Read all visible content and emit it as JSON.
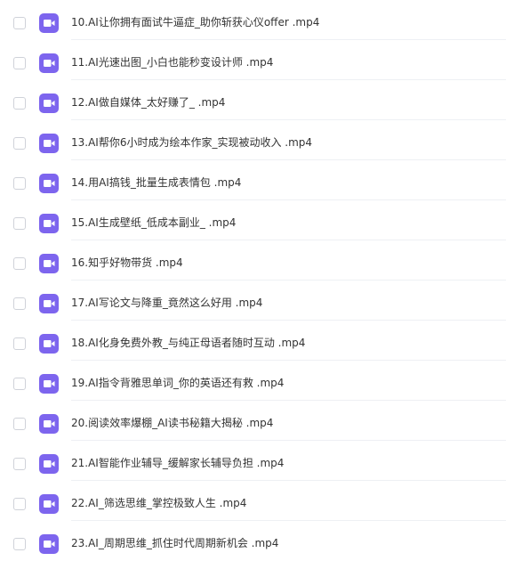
{
  "files": [
    {
      "name": "10.AI让你拥有面试牛逼症_助你斩获心仪offer .mp4",
      "icon": "video-file-icon"
    },
    {
      "name": "11.AI光速出图_小白也能秒变设计师 .mp4",
      "icon": "video-file-icon"
    },
    {
      "name": "12.AI做自媒体_太好赚了_ .mp4",
      "icon": "video-file-icon"
    },
    {
      "name": "13.AI帮你6小时成为绘本作家_实现被动收入 .mp4",
      "icon": "video-file-icon"
    },
    {
      "name": "14.用AI搞钱_批量生成表情包 .mp4",
      "icon": "video-file-icon"
    },
    {
      "name": "15.AI生成壁纸_低成本副业_ .mp4",
      "icon": "video-file-icon"
    },
    {
      "name": "16.知乎好物带货 .mp4",
      "icon": "video-file-icon"
    },
    {
      "name": "17.AI写论文与降重_竟然这么好用 .mp4",
      "icon": "video-file-icon"
    },
    {
      "name": "18.AI化身免费外教_与纯正母语者随时互动 .mp4",
      "icon": "video-file-icon"
    },
    {
      "name": "19.AI指令背雅思单词_你的英语还有救 .mp4",
      "icon": "video-file-icon"
    },
    {
      "name": "20.阅读效率爆棚_AI读书秘籍大揭秘 .mp4",
      "icon": "video-file-icon"
    },
    {
      "name": "21.AI智能作业辅导_缓解家长辅导负担 .mp4",
      "icon": "video-file-icon"
    },
    {
      "name": "22.AI_筛选思维_掌控极致人生 .mp4",
      "icon": "video-file-icon"
    },
    {
      "name": "23.AI_周期思维_抓住时代周期新机会 .mp4",
      "icon": "video-file-icon"
    }
  ],
  "colors": {
    "icon_bg": "#7d65ee",
    "text": "#333333",
    "checkbox_border": "#cfd2d9",
    "divider": "#eef0f4"
  }
}
